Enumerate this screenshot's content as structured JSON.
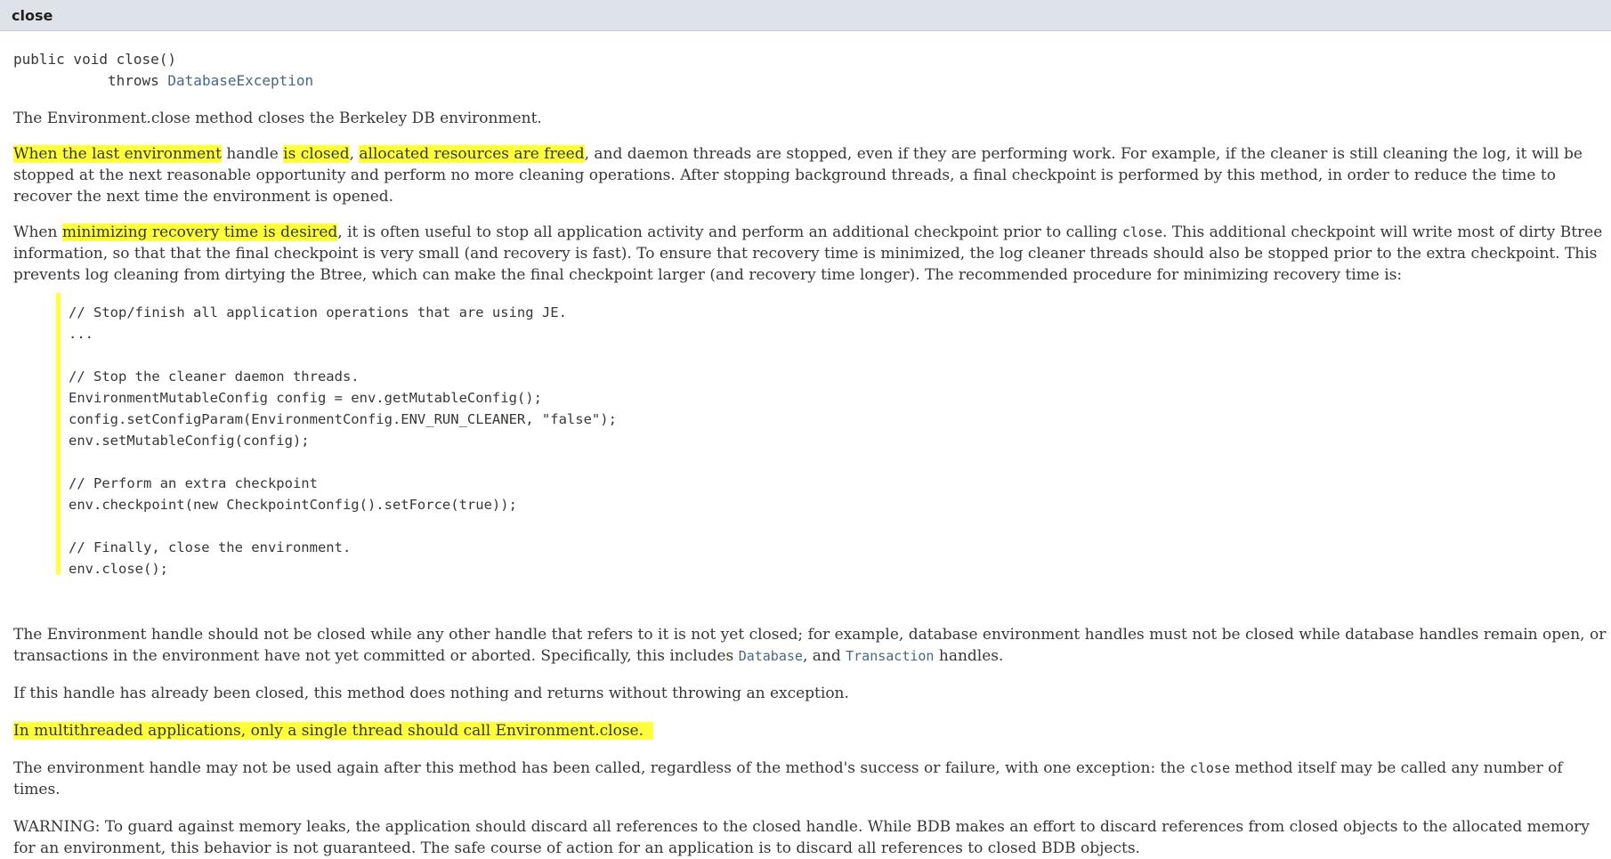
{
  "header": {
    "title": "close"
  },
  "signature": {
    "line1": "public void close()",
    "throws_kw": "throws",
    "exception": "DatabaseException"
  },
  "p1": "The Environment.close method closes the Berkeley DB environment.",
  "p2": {
    "h1": "When the last environment",
    "t1": " handle ",
    "h2": "is closed",
    "t2": ", ",
    "h3": "allocated resources are freed",
    "t3": ", and daemon threads are stopped, even if they are performing work. For example, if the cleaner is still cleaning the log, it will be stopped at the next reasonable opportunity and perform no more cleaning operations. After stopping background threads, a final checkpoint is performed by this method, in order to reduce the time to recover the next time the environment is opened."
  },
  "p3": {
    "t0": "When ",
    "h1": "minimizing recovery time is desired",
    "t1": ", it is often useful to stop all application activity and perform an additional checkpoint prior to calling ",
    "code": "close",
    "t2": ". This additional checkpoint will write most of dirty Btree information, so that that the final checkpoint is very small (and recovery is fast). To ensure that recovery time is minimized, the log cleaner threads should also be stopped prior to the extra checkpoint. This prevents log cleaning from dirtying the Btree, which can make the final checkpoint larger (and recovery time longer). The recommended procedure for minimizing recovery time is:"
  },
  "code_lines": [
    "// Stop/finish all application operations that are using JE.",
    "...",
    "",
    "// Stop the cleaner daemon threads.",
    "EnvironmentMutableConfig config = env.getMutableConfig();",
    "config.setConfigParam(EnvironmentConfig.ENV_RUN_CLEANER, \"false\");",
    "env.setMutableConfig(config);",
    "",
    "// Perform an extra checkpoint",
    "env.checkpoint(new CheckpointConfig().setForce(true));",
    "",
    "// Finally, close the environment.",
    "env.close();"
  ],
  "p4": {
    "t1": "The Environment handle should not be closed while any other handle that refers to it is not yet closed; for example, database environment handles must not be closed while database handles remain open, or transactions in the environment have not yet committed or aborted. Specifically, this includes ",
    "link1": "Database",
    "t2": ", and ",
    "link2": "Transaction",
    "t3": " handles."
  },
  "p5": "If this handle has already been closed, this method does nothing and returns without throwing an exception.",
  "p6": "In multithreaded applications, only a single thread should call Environment.close.",
  "p7": {
    "t1": "The environment handle may not be used again after this method has been called, regardless of the method's success or failure, with one exception: the ",
    "code": "close",
    "t2": " method itself may be called any number of times."
  },
  "p8": "WARNING: To guard against memory leaks, the application should discard all references to the closed handle. While BDB makes an effort to discard references from closed objects to the allocated memory for an environment, this behavior is not guaranteed. The safe course of action for an application is to discard all references to closed BDB objects.",
  "colors": {
    "highlight": "#ffff3a",
    "header_bg": "#dee3e9",
    "link": "#4a6782",
    "text": "#353833"
  }
}
